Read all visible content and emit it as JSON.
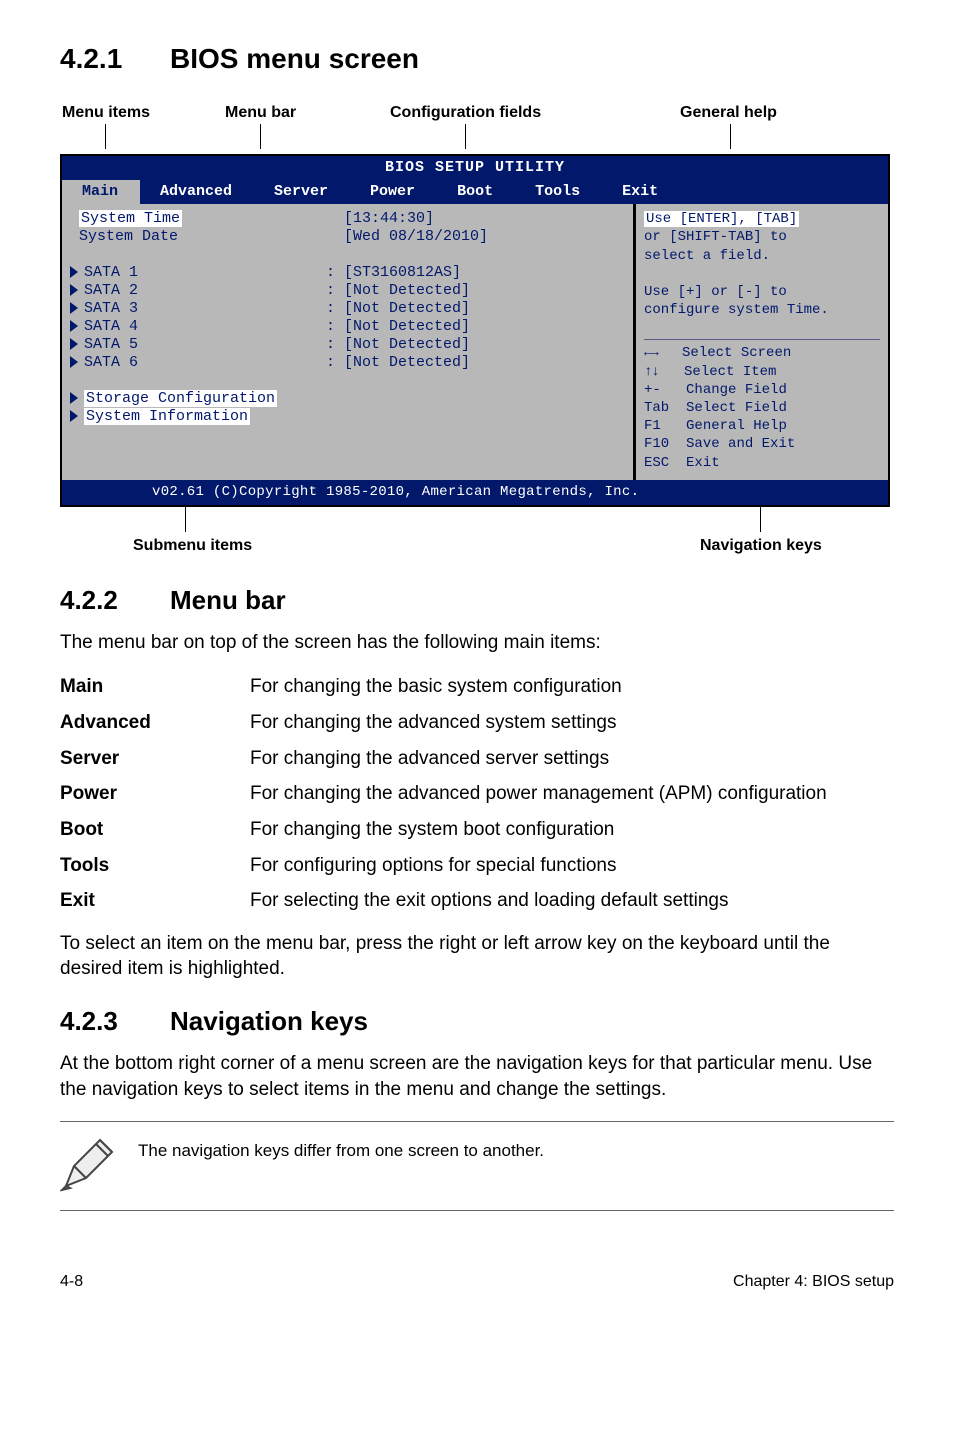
{
  "section1": {
    "num": "4.2.1",
    "title": "BIOS menu screen"
  },
  "topAnno": {
    "menuItems": "Menu items",
    "menuBar": "Menu bar",
    "configFields": "Configuration fields",
    "generalHelp": "General help"
  },
  "bios": {
    "titlebar": "BIOS SETUP UTILITY",
    "menu": [
      "Main",
      "Advanced",
      "Server",
      "Power",
      "Boot",
      "Tools",
      "Exit"
    ],
    "items": {
      "systemTime": "System Time",
      "systemDate": "System Date",
      "sata": [
        "SATA 1",
        "SATA 2",
        "SATA 3",
        "SATA 4",
        "SATA 5",
        "SATA 6"
      ],
      "storageCfg": "Storage Configuration",
      "sysInfo": "System Information"
    },
    "values": {
      "time": "[13:44:30]",
      "date": "[Wed 08/18/2010]",
      "sataVals": [
        "[ST3160812AS]",
        "[Not Detected]",
        "[Not Detected]",
        "[Not Detected]",
        "[Not Detected]",
        "[Not Detected]"
      ]
    },
    "help": {
      "l1": "Use [ENTER], [TAB]",
      "l2": "or [SHIFT-TAB] to",
      "l3": "select a field.",
      "l4": "Use [+] or [-] to",
      "l5": "configure system Time."
    },
    "nav": {
      "selectScreen": "Select Screen",
      "selectItem": "Select Item",
      "changeField": "Change Field",
      "selectField": "Select Field",
      "generalHelp": "General Help",
      "saveExit": "Save and Exit",
      "exit": "Exit",
      "kTab": "Tab",
      "kF1": "F1",
      "kF10": "F10",
      "kEsc": "ESC",
      "kPM": "+-"
    },
    "footer": "v02.61 (C)Copyright 1985-2010, American Megatrends, Inc."
  },
  "bottomAnno": {
    "submenu": "Submenu items",
    "navkeys": "Navigation keys"
  },
  "section2": {
    "num": "4.2.2",
    "title": "Menu bar"
  },
  "menubarIntro": "The menu bar on top of the screen has the following main items:",
  "defs": [
    {
      "term": "Main",
      "desc": "For changing the basic system configuration"
    },
    {
      "term": "Advanced",
      "desc": "For changing the advanced system settings"
    },
    {
      "term": "Server",
      "desc": "For changing the advanced server settings"
    },
    {
      "term": "Power",
      "desc": "For changing the advanced power management (APM) configuration"
    },
    {
      "term": "Boot",
      "desc": "For changing the system boot configuration"
    },
    {
      "term": "Tools",
      "desc": "For configuring options for special functions"
    },
    {
      "term": "Exit",
      "desc": "For selecting the exit options and loading default settings"
    }
  ],
  "menubarOutro": "To select an item on the menu bar, press the right or left arrow key on the keyboard until the desired item is highlighted.",
  "section3": {
    "num": "4.2.3",
    "title": "Navigation keys"
  },
  "navPara": "At the bottom right corner of a menu screen are the navigation keys for that particular menu. Use the navigation keys to select items in the menu and change the settings.",
  "noteText": "The navigation keys differ from one screen to another.",
  "pageFooter": {
    "left": "4-8",
    "right": "Chapter 4: BIOS setup"
  }
}
